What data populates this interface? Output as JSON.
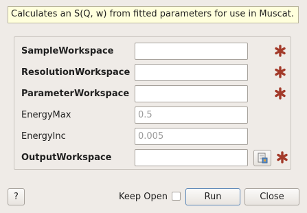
{
  "description": "Calculates an S(Q, w) from fitted parameters for use in Muscat.",
  "fields": [
    {
      "label": "SampleWorkspace",
      "value": "",
      "placeholder": "",
      "mandatory": true
    },
    {
      "label": "ResolutionWorkspace",
      "value": "",
      "placeholder": "",
      "mandatory": true
    },
    {
      "label": "ParameterWorkspace",
      "value": "",
      "placeholder": "",
      "mandatory": true
    },
    {
      "label": "EnergyMax",
      "value": "",
      "placeholder": "0.5",
      "mandatory": false
    },
    {
      "label": "EnergyInc",
      "value": "",
      "placeholder": "0.005",
      "mandatory": false
    },
    {
      "label": "OutputWorkspace",
      "value": "",
      "placeholder": "",
      "mandatory": true
    }
  ],
  "buttons": {
    "help": "?",
    "keep_open": "Keep Open",
    "run": "Run",
    "close": "Close"
  },
  "colors": {
    "mandatory_star": "#a33a2a",
    "background": "#efebe7",
    "description_bg": "#ffffdc"
  },
  "icons": {
    "mandatory": "asterisk-icon",
    "browse": "workspace-browse-icon"
  }
}
